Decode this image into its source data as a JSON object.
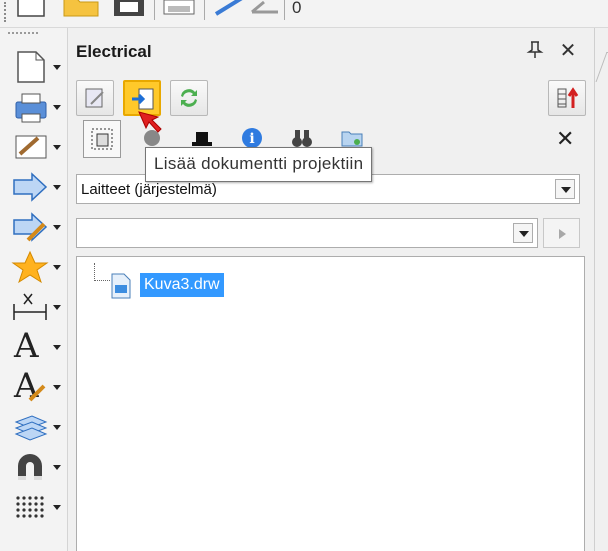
{
  "topbar": {
    "value_text": "0"
  },
  "panel": {
    "title": "Electrical",
    "tooltip": "Lisää dokumentti projektiin"
  },
  "category_select": {
    "value": "Laitteet (järjestelmä)"
  },
  "filter_select": {
    "value": ""
  },
  "tree": {
    "items": [
      {
        "label": "Kuva3.drw"
      }
    ]
  },
  "colors": {
    "selection": "#3399ff",
    "active_button": "#ffc92a",
    "red_arrow": "#e02020"
  }
}
